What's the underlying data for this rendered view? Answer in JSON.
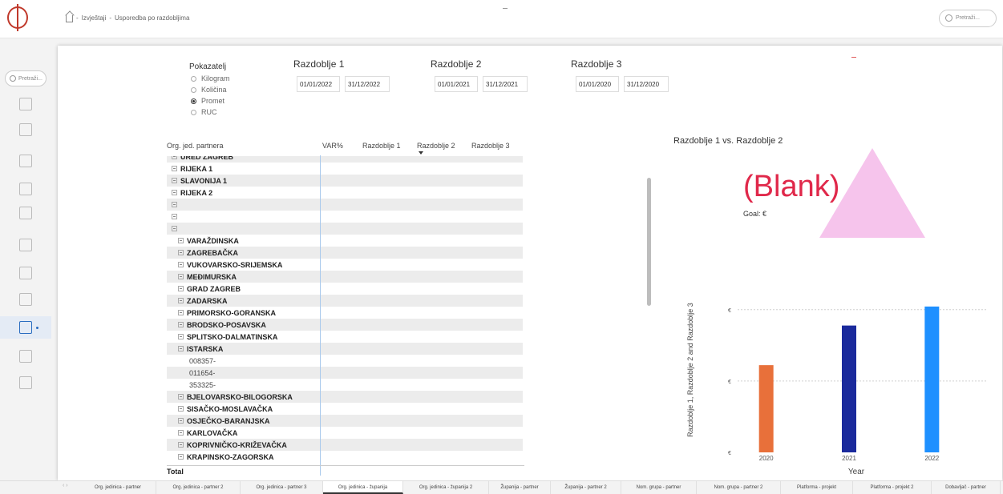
{
  "breadcrumb": {
    "home": "home-icon",
    "items": [
      "Izvještaji",
      "Usporedba po razdobljima"
    ],
    "separator": "-"
  },
  "top_search": {
    "placeholder": "Pretraži..."
  },
  "rail": {
    "search_placeholder": "Pretraži...",
    "icons": [
      "home-icon",
      "briefcase-icon",
      "document-icon",
      "shopping-bag-icon",
      "clipboard-icon",
      "cart-icon",
      "coins-icon",
      "location-icon",
      "chart-icon",
      "calendar-icon",
      "inbox-icon"
    ],
    "active_index": 8
  },
  "indicator": {
    "title": "Pokazatelj",
    "options": [
      {
        "label": "Kilogram",
        "selected": false
      },
      {
        "label": "Količina",
        "selected": false
      },
      {
        "label": "Promet",
        "selected": true
      },
      {
        "label": "RUC",
        "selected": false
      }
    ]
  },
  "periods": [
    {
      "title": "Razdoblje 1",
      "from": "01/01/2022",
      "to": "31/12/2022"
    },
    {
      "title": "Razdoblje 2",
      "from": "01/01/2021",
      "to": "31/12/2021"
    },
    {
      "title": "Razdoblje 3",
      "from": "01/01/2020",
      "to": "31/12/2020"
    }
  ],
  "matrix": {
    "columns": [
      "Org. jed. partnera",
      "VAR%",
      "Razdoblje 1",
      "Razdoblje 2",
      "Razdoblje 3"
    ],
    "sorted_column": "Razdoblje 2",
    "rows": [
      {
        "label": "URED ZAGREB",
        "level": 0,
        "expander": true
      },
      {
        "label": "RIJEKA 1",
        "level": 0,
        "expander": true
      },
      {
        "label": "SLAVONIJA 1",
        "level": 0,
        "expander": true
      },
      {
        "label": "RIJEKA 2",
        "level": 0,
        "expander": true
      },
      {
        "label": "",
        "level": 0,
        "expander": true
      },
      {
        "label": "",
        "level": 0,
        "expander": true
      },
      {
        "label": "",
        "level": 0,
        "expander": true
      },
      {
        "label": "VARAŽDINSKA",
        "level": 1,
        "expander": true
      },
      {
        "label": "ZAGREBAČKA",
        "level": 1,
        "expander": true
      },
      {
        "label": "VUKOVARSKO-SRIJEMSKA",
        "level": 1,
        "expander": true
      },
      {
        "label": "MEĐIMURSKA",
        "level": 1,
        "expander": true
      },
      {
        "label": "GRAD ZAGREB",
        "level": 1,
        "expander": true
      },
      {
        "label": "ZADARSKA",
        "level": 1,
        "expander": true
      },
      {
        "label": "PRIMORSKO-GORANSKA",
        "level": 1,
        "expander": true
      },
      {
        "label": "BRODSKO-POSAVSKA",
        "level": 1,
        "expander": true
      },
      {
        "label": "SPLITSKO-DALMATINSKA",
        "level": 1,
        "expander": true
      },
      {
        "label": "ISTARSKA",
        "level": 1,
        "expander": true
      },
      {
        "label": "008357-",
        "level": 2,
        "expander": false
      },
      {
        "label": "011654-",
        "level": 2,
        "expander": false
      },
      {
        "label": "353325-",
        "level": 2,
        "expander": false
      },
      {
        "label": "BJELOVARSKO-BILOGORSKA",
        "level": 1,
        "expander": true
      },
      {
        "label": "SISAČKO-MOSLAVAČKA",
        "level": 1,
        "expander": true
      },
      {
        "label": "OSJEČKO-BARANJSKA",
        "level": 1,
        "expander": true
      },
      {
        "label": "KARLOVAČKA",
        "level": 1,
        "expander": true
      },
      {
        "label": "KOPRIVNIČKO-KRIŽEVAČKA",
        "level": 1,
        "expander": true
      },
      {
        "label": "KRAPINSKO-ZAGORSKA",
        "level": 1,
        "expander": true
      }
    ],
    "total_label": "Total"
  },
  "kpi": {
    "title": "Razdoblje 1 vs. Razdoblje 2",
    "value": "(Blank)",
    "goal": "Goal: €"
  },
  "chart_data": {
    "type": "bar",
    "categories": [
      "2020",
      "2021",
      "2022"
    ],
    "values": [
      0.55,
      0.8,
      0.92
    ],
    "colors": [
      "#e8703a",
      "#1a2a9c",
      "#1e90ff"
    ],
    "xlabel": "Year",
    "ylabel": "Razdoblje 1, Razdoblje 2 and Razdoblje 3",
    "ytick_labels": [
      "€",
      "€",
      "€"
    ],
    "ylim": [
      0,
      1
    ],
    "grid": true
  },
  "tabs": {
    "items": [
      "Org. jedinica - partner",
      "Org. jedinica - partner 2",
      "Org. jedinica - partner 3",
      "Org. jedinica - županija",
      "Org. jedinica - županija 2",
      "Županija - partner",
      "Županija - partner 2",
      "Nom. grupa - partner",
      "Nom. grupa - partner 2",
      "Platforma - projekt",
      "Platforma - projekt 2",
      "Dobavljač - partner"
    ],
    "active_index": 3,
    "nav": "‹ ›"
  }
}
